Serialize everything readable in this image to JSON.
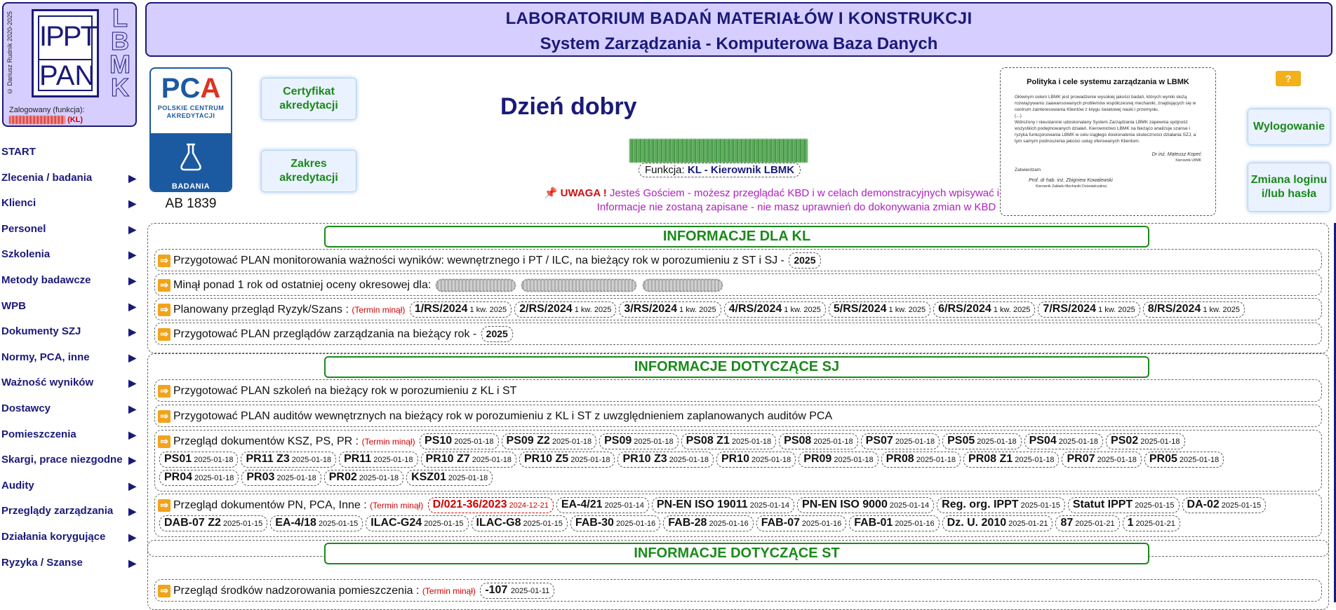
{
  "logo": {
    "copyright": "© Dariusz Rudnik 2020-2025",
    "ippt_line1": "IPPT",
    "ippt_line2": "PAN",
    "lbmk": "LBMK",
    "logged_label": "Zalogowany (funkcja):",
    "logged_role": "(KL)"
  },
  "header": {
    "title": "LABORATORIUM BADAŃ MATERIAŁÓW I KONSTRUKCJI",
    "subtitle": "System Zarządzania - Komputerowa Baza Danych"
  },
  "menu": {
    "items": [
      {
        "label": "START",
        "arrow": ""
      },
      {
        "label": "Zlecenia / badania",
        "arrow": "▶"
      },
      {
        "label": "Klienci",
        "arrow": "▶"
      },
      {
        "label": "Personel",
        "arrow": "▶"
      },
      {
        "label": "Szkolenia",
        "arrow": "▶"
      },
      {
        "label": "Metody badawcze",
        "arrow": "▶"
      },
      {
        "label": "WPB",
        "arrow": "▶"
      },
      {
        "label": "Dokumenty SZJ",
        "arrow": "▶"
      },
      {
        "label": "Normy, PCA, inne",
        "arrow": "▶"
      },
      {
        "label": "Ważność wyników",
        "arrow": "▶"
      },
      {
        "label": "Dostawcy",
        "arrow": "▶"
      },
      {
        "label": "Pomieszczenia",
        "arrow": "▶"
      },
      {
        "label": "Skargi, prace niezgodne",
        "arrow": "▶"
      },
      {
        "label": "Audity",
        "arrow": "▶"
      },
      {
        "label": "Przeglądy zarządzania",
        "arrow": "▶"
      },
      {
        "label": "Działania korygujące",
        "arrow": "▶"
      },
      {
        "label": "Ryzyka / Szanse",
        "arrow": "▶"
      }
    ]
  },
  "pca": {
    "logo_pc": "PC",
    "logo_a": "A",
    "sub1": "POLSKIE CENTRUM",
    "sub2": "AKREDYTACJI",
    "badania": "BADANIA",
    "ab": "AB 1839"
  },
  "buttons": {
    "certyfikat": "Certyfikat akredytacji",
    "zakres": "Zakres akredytacji",
    "wylogowanie": "Wylogowanie",
    "zmiana": "Zmiana loginu i/lub hasła",
    "help": "?"
  },
  "greeting": {
    "text": "Dzień dobry",
    "funkcja_label": "Funkcja:",
    "funkcja_value": "KL - Kierownik LBMK",
    "uwaga_label": "📌 UWAGA !",
    "uwaga_line1": " Jesteś Gościem - możesz przeglądać KBD i w celach demonstracyjnych wpisywać informacje.",
    "uwaga_line2": "Informacje nie zostaną zapisane - nie masz uprawnień do dokonywania zmian w KBD"
  },
  "policy": {
    "title": "Polityka i cele systemu zarządzania w LBMK",
    "p1": "Głównym celem LBMK jest prowadzenie wysokiej jakości badań, których wyniki służą rozwiązywaniu zaawansowanych problemów współczesnej mechaniki, znajdujących się w centrum zainteresowania Klientów z kręgu światowej nauki i przemysłu.",
    "p2": "(...)",
    "p3": "Wdrożony i nieustannie udoskonalany System Zarządzania LBMK zapewnia spójność wszystkich podejmowanych działań. Kierownictwo LBMK na bieżąco analizuje szanse i ryzyka funkcjonowania LBMK w celu ciągłego doskonalenia skuteczności działania SZJ, a tym samym podnoszenia jakości usług oferowanych Klientom.",
    "sig1_name": "Dr inż. Mateusz Kopeć",
    "sig1_role": "Kierownik LBMK",
    "approve": "Zatwierdzam",
    "sig2_name": "Prof. dr hab. inż. Zbigniew Kowalewski",
    "sig2_role": "Kierownik Zakładu Mechaniki Doświadczalnej"
  },
  "sections": {
    "kl_title": "INFORMACJE DLA KL",
    "sj_title": "INFORMACJE DOTYCZĄCE SJ",
    "st_title": "INFORMACJE DOTYCZĄCE ST"
  },
  "kl": {
    "r1_text": "Przygotować PLAN monitorowania ważności wyników: wewnętrznego i PT / ILC, na bieżący rok w porozumieniu z ST i SJ -",
    "r1_chip": "2025",
    "r2_text": "Minął ponad 1 rok od ostatniej oceny okresowej dla:",
    "r3_text": "Planowany przegląd Ryzyk/Szans :",
    "r3_term": "(Termin minął)",
    "r3_chips": [
      {
        "id": "1/RS/2024",
        "date": "1 kw. 2025"
      },
      {
        "id": "2/RS/2024",
        "date": "1 kw. 2025"
      },
      {
        "id": "3/RS/2024",
        "date": "1 kw. 2025"
      },
      {
        "id": "4/RS/2024",
        "date": "1 kw. 2025"
      },
      {
        "id": "5/RS/2024",
        "date": "1 kw. 2025"
      },
      {
        "id": "6/RS/2024",
        "date": "1 kw. 2025"
      },
      {
        "id": "7/RS/2024",
        "date": "1 kw. 2025"
      },
      {
        "id": "8/RS/2024",
        "date": "1 kw. 2025"
      }
    ],
    "r4_text": "Przygotować PLAN przeglądów zarządzania na bieżący rok -",
    "r4_chip": "2025"
  },
  "sj": {
    "r1_text": "Przygotować PLAN szkoleń na bieżący rok w porozumieniu z KL i ST",
    "r2_text": "Przygotować PLAN auditów wewnętrznych na bieżący rok w porozumieniu z KL i ST z uwzględnieniem zaplanowanych auditów PCA",
    "r3_text": "Przegląd dokumentów KSZ, PS, PR :",
    "r3_term": "(Termin minął)",
    "r3_chips_a": [
      {
        "id": "PS10",
        "date": "2025-01-18"
      },
      {
        "id": "PS09 Z2",
        "date": "2025-01-18"
      },
      {
        "id": "PS09",
        "date": "2025-01-18"
      },
      {
        "id": "PS08 Z1",
        "date": "2025-01-18"
      },
      {
        "id": "PS08",
        "date": "2025-01-18"
      },
      {
        "id": "PS07",
        "date": "2025-01-18"
      },
      {
        "id": "PS05",
        "date": "2025-01-18"
      },
      {
        "id": "PS04",
        "date": "2025-01-18"
      },
      {
        "id": "PS02",
        "date": "2025-01-18"
      }
    ],
    "r3_chips_b": [
      {
        "id": "PS01",
        "date": "2025-01-18"
      },
      {
        "id": "PR11 Z3",
        "date": "2025-01-18"
      },
      {
        "id": "PR11",
        "date": "2025-01-18"
      },
      {
        "id": "PR10 Z7",
        "date": "2025-01-18"
      },
      {
        "id": "PR10 Z5",
        "date": "2025-01-18"
      },
      {
        "id": "PR10 Z3",
        "date": "2025-01-18"
      },
      {
        "id": "PR10",
        "date": "2025-01-18"
      },
      {
        "id": "PR09",
        "date": "2025-01-18"
      },
      {
        "id": "PR08",
        "date": "2025-01-18"
      },
      {
        "id": "PR08 Z1",
        "date": "2025-01-18"
      },
      {
        "id": "PR07",
        "date": "2025-01-18"
      },
      {
        "id": "PR05",
        "date": "2025-01-18"
      }
    ],
    "r3_chips_c": [
      {
        "id": "PR04",
        "date": "2025-01-18"
      },
      {
        "id": "PR03",
        "date": "2025-01-18"
      },
      {
        "id": "PR02",
        "date": "2025-01-18"
      },
      {
        "id": "KSZ01",
        "date": "2025-01-18"
      }
    ],
    "r4_text": "Przegląd dokumentów PN, PCA, Inne :",
    "r4_term": "(Termin minął)",
    "r4_chips_a": [
      {
        "id": "D/021-36/2023",
        "date": "2024-12-21",
        "red": true
      },
      {
        "id": "EA-4/21",
        "date": "2025-01-14"
      },
      {
        "id": "PN-EN ISO 19011",
        "date": "2025-01-14"
      },
      {
        "id": "PN-EN ISO 9000",
        "date": "2025-01-14"
      },
      {
        "id": "Reg. org. IPPT",
        "date": "2025-01-15"
      },
      {
        "id": "Statut IPPT",
        "date": "2025-01-15"
      },
      {
        "id": "DA-02",
        "date": "2025-01-15"
      }
    ],
    "r4_chips_b": [
      {
        "id": "DAB-07 Z2",
        "date": "2025-01-15"
      },
      {
        "id": "EA-4/18",
        "date": "2025-01-15"
      },
      {
        "id": "ILAC-G24",
        "date": "2025-01-15"
      },
      {
        "id": "ILAC-G8",
        "date": "2025-01-15"
      },
      {
        "id": "FAB-30",
        "date": "2025-01-16"
      },
      {
        "id": "FAB-28",
        "date": "2025-01-16"
      },
      {
        "id": "FAB-07",
        "date": "2025-01-16"
      },
      {
        "id": "FAB-01",
        "date": "2025-01-16"
      },
      {
        "id": "Dz. U. 2010",
        "date": "2025-01-21"
      },
      {
        "id": "87",
        "date": "2025-01-21"
      },
      {
        "id": "1",
        "date": "2025-01-21"
      }
    ]
  },
  "st": {
    "r1_text": "Przegląd środków nadzorowania pomieszczenia :",
    "r1_term": "(Termin minął)",
    "r1_chip_id": "-107",
    "r1_chip_date": "2025-01-11"
  }
}
